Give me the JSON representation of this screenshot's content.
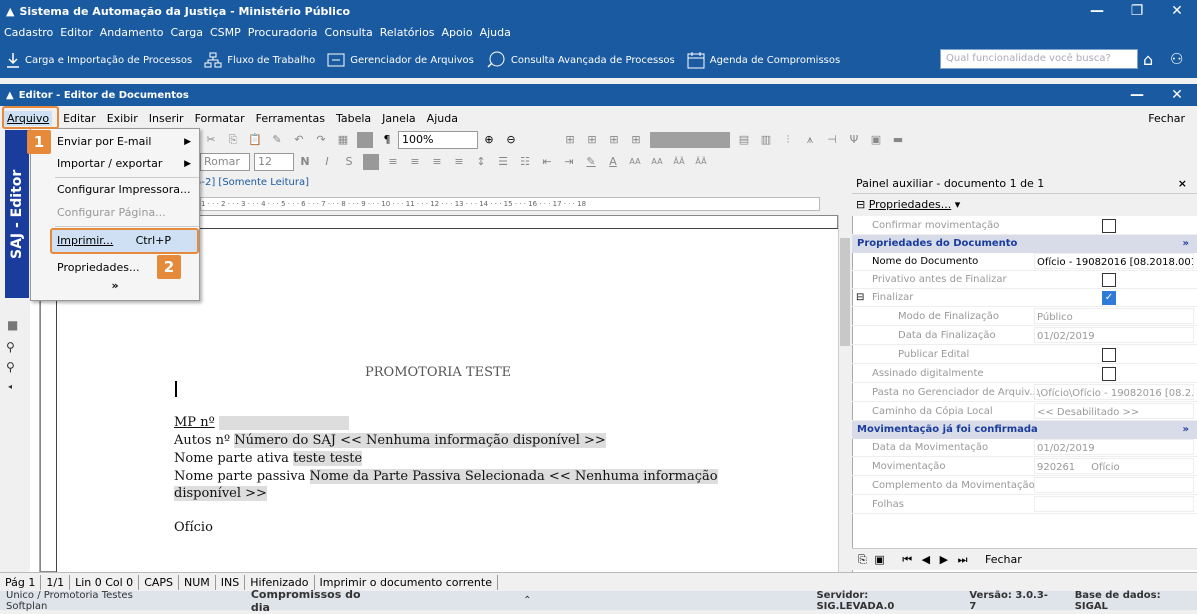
{
  "outer_window": {
    "title": "Sistema de Automação da Justiça - Ministério Público",
    "menu": [
      "Cadastro",
      "Editor",
      "Andamento",
      "Carga",
      "CSMP",
      "Procuradoria",
      "Consulta",
      "Relatórios",
      "Apoio",
      "Ajuda"
    ],
    "toolbar": [
      {
        "label": "Carga e Importação de Processos",
        "icon": "download-icon"
      },
      {
        "label": "Fluxo de Trabalho",
        "icon": "workflow-icon"
      },
      {
        "label": "Gerenciador de Arquivos",
        "icon": "file-manager-icon"
      },
      {
        "label": "Consulta Avançada de Processos",
        "icon": "search-process-icon"
      },
      {
        "label": "Agenda de Compromissos",
        "icon": "calendar-icon"
      }
    ],
    "search_placeholder": "Qual funcionalidade você busca?"
  },
  "editor": {
    "title": "Editor - Editor de Documentos",
    "menu": [
      "Arquivo",
      "Editar",
      "Exibir",
      "Inserir",
      "Formatar",
      "Ferramentas",
      "Tabela",
      "Janela",
      "Ajuda"
    ],
    "close_label": "Fechar",
    "zoom": "100%",
    "font_name": "Romar",
    "font_size": "12",
    "tab_label": "5-2] [Somente Leitura]",
    "ruler_text": "1 · · · 2 · · · 3 · · · 4 · · · 5 · · · 6 · · · 7 · · · 8 · · · 9 · · · 10 · · · 11 · · · 12 · · · 13 · · · 14 · · · 15 · · · 16 · · · 17 · · · 18",
    "side_logo": "SAJ - Editor"
  },
  "file_menu": {
    "items": [
      {
        "label": "Enviar por E-mail",
        "submenu": true
      },
      {
        "label": "Importar / exportar",
        "submenu": true
      },
      {
        "label": "Configurar Impressora..."
      },
      {
        "label": "Configurar Página...",
        "disabled": true
      },
      {
        "label": "Imprimir...",
        "shortcut": "Ctrl+P"
      },
      {
        "label": "Propriedades..."
      }
    ],
    "more": "»"
  },
  "badges": [
    "1",
    "2"
  ],
  "document": {
    "heading": "PROMOTORIA TESTE",
    "line1_label": "MP nº",
    "line2_label": "Autos nº",
    "line2_value": "Número do SAJ << Nenhuma informação disponível >>",
    "line3_label": "Nome parte ativa",
    "line3_value": "teste teste",
    "line4_label": "Nome parte passiva",
    "line4_value": "Nome da Parte Passiva Selecionada << Nenhuma informação",
    "line5_value": "disponível >>",
    "line6": "Ofício"
  },
  "panel": {
    "title": "Painel auxiliar - documento 1 de 1",
    "close": "×",
    "properties_label": "Propriedades...",
    "rows": [
      {
        "key": "Confirmar movimentação",
        "type": "check",
        "checked": false
      },
      {
        "key": "Propriedades do Documento",
        "type": "header"
      },
      {
        "key": "Nome do Documento",
        "value": "Ofício - 19082016 [08.2018.001...",
        "dark": true
      },
      {
        "key": "Privativo antes de Finalizar",
        "type": "check",
        "checked": false
      },
      {
        "key": "Finalizar",
        "type": "check",
        "checked": true,
        "expander": true
      },
      {
        "key": "Modo de Finalização",
        "value": "Público",
        "indent": true
      },
      {
        "key": "Data da Finalização",
        "value": "01/02/2019",
        "indent": true
      },
      {
        "key": "Publicar Edital",
        "type": "check",
        "checked": false,
        "indent": true
      },
      {
        "key": "Assinado digitalmente",
        "type": "check",
        "checked": false
      },
      {
        "key": "Pasta no Gerenciador de Arquiv...",
        "value": "\\Ofício\\Ofício - 19082016 [08.2..."
      },
      {
        "key": "Caminho da Cópia Local",
        "value": "<< Desabilitado >>"
      },
      {
        "key": "Movimentação já foi confirmada",
        "type": "header"
      },
      {
        "key": "Data da Movimentação",
        "value": "01/02/2019"
      },
      {
        "key": "Movimentação",
        "value": "920261     Ofício"
      },
      {
        "key": "Complemento da Movimentação",
        "value": ""
      },
      {
        "key": "Folhas",
        "value": ""
      }
    ],
    "footer_close": "Fechar"
  },
  "status": [
    "Pág 1",
    "1/1",
    "Lin 0  Col 0",
    "CAPS",
    "NUM",
    "INS",
    "Hifenizado",
    "Imprimir o documento corrente"
  ],
  "bottom": {
    "left": "Unico / Promotoria Testes Softplan",
    "center": "Compromissos do dia",
    "server": "Servidor: SIG.LEVADA.0",
    "version": "Versão: 3.0.3-7",
    "database": "Base de dados: SIGAL"
  },
  "colors": {
    "brand_blue": "#1a5aa0",
    "highlight_orange": "#e58a3a",
    "saj_blue": "#1a3c9c"
  }
}
